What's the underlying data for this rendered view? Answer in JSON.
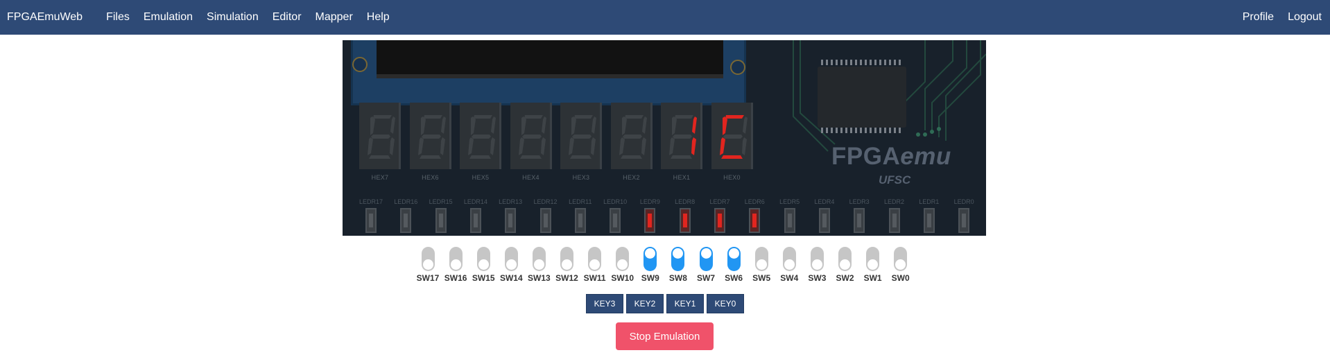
{
  "navbar": {
    "brand": "FPGAEmuWeb",
    "menu": [
      "Files",
      "Emulation",
      "Simulation",
      "Editor",
      "Mapper",
      "Help"
    ],
    "right": [
      "Profile",
      "Logout"
    ]
  },
  "board": {
    "logo_main": "FPGA",
    "logo_emu": "emu",
    "logo_sub": "UFSC",
    "hex_displays": [
      {
        "label": "HEX7",
        "digit": "",
        "on_segments": []
      },
      {
        "label": "HEX6",
        "digit": "",
        "on_segments": []
      },
      {
        "label": "HEX5",
        "digit": "",
        "on_segments": []
      },
      {
        "label": "HEX4",
        "digit": "",
        "on_segments": []
      },
      {
        "label": "HEX3",
        "digit": "",
        "on_segments": []
      },
      {
        "label": "HEX2",
        "digit": "",
        "on_segments": []
      },
      {
        "label": "HEX1",
        "digit": "1",
        "on_segments": [
          "b",
          "c"
        ]
      },
      {
        "label": "HEX0",
        "digit": "C",
        "on_segments": [
          "a",
          "d",
          "e",
          "f"
        ]
      }
    ],
    "leds": [
      {
        "label": "LEDR17",
        "on": false
      },
      {
        "label": "LEDR16",
        "on": false
      },
      {
        "label": "LEDR15",
        "on": false
      },
      {
        "label": "LEDR14",
        "on": false
      },
      {
        "label": "LEDR13",
        "on": false
      },
      {
        "label": "LEDR12",
        "on": false
      },
      {
        "label": "LEDR11",
        "on": false
      },
      {
        "label": "LEDR10",
        "on": false
      },
      {
        "label": "LEDR9",
        "on": true
      },
      {
        "label": "LEDR8",
        "on": true
      },
      {
        "label": "LEDR7",
        "on": true
      },
      {
        "label": "LEDR6",
        "on": true
      },
      {
        "label": "LEDR5",
        "on": false
      },
      {
        "label": "LEDR4",
        "on": false
      },
      {
        "label": "LEDR3",
        "on": false
      },
      {
        "label": "LEDR2",
        "on": false
      },
      {
        "label": "LEDR1",
        "on": false
      },
      {
        "label": "LEDR0",
        "on": false
      }
    ],
    "colors": {
      "segment_on": "#e1251f",
      "segment_off": "#3e4347",
      "led_on": "#e1251f",
      "switch_on": "#2196f3"
    }
  },
  "switches": [
    {
      "label": "SW17",
      "on": false
    },
    {
      "label": "SW16",
      "on": false
    },
    {
      "label": "SW15",
      "on": false
    },
    {
      "label": "SW14",
      "on": false
    },
    {
      "label": "SW13",
      "on": false
    },
    {
      "label": "SW12",
      "on": false
    },
    {
      "label": "SW11",
      "on": false
    },
    {
      "label": "SW10",
      "on": false
    },
    {
      "label": "SW9",
      "on": true
    },
    {
      "label": "SW8",
      "on": true
    },
    {
      "label": "SW7",
      "on": true
    },
    {
      "label": "SW6",
      "on": true
    },
    {
      "label": "SW5",
      "on": false
    },
    {
      "label": "SW4",
      "on": false
    },
    {
      "label": "SW3",
      "on": false
    },
    {
      "label": "SW2",
      "on": false
    },
    {
      "label": "SW1",
      "on": false
    },
    {
      "label": "SW0",
      "on": false
    }
  ],
  "keys": [
    "KEY3",
    "KEY2",
    "KEY1",
    "KEY0"
  ],
  "stop_button": "Stop Emulation"
}
